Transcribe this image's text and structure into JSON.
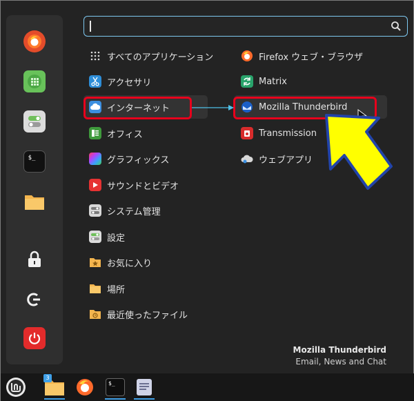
{
  "search": {
    "placeholder": ""
  },
  "favorites": [
    {
      "name": "firefox"
    },
    {
      "name": "calculator"
    },
    {
      "name": "settings"
    },
    {
      "name": "terminal"
    },
    {
      "name": "files"
    },
    {
      "name": "lock"
    },
    {
      "name": "logout"
    },
    {
      "name": "power"
    }
  ],
  "categories": [
    {
      "label": "すべてのアプリケーション",
      "icon": "grid-icon"
    },
    {
      "label": "アクセサリ",
      "icon": "scissors-icon"
    },
    {
      "label": "インターネット",
      "icon": "cloud-icon"
    },
    {
      "label": "オフィス",
      "icon": "office-icon"
    },
    {
      "label": "グラフィックス",
      "icon": "graphics-icon"
    },
    {
      "label": "サウンドとビデオ",
      "icon": "play-icon"
    },
    {
      "label": "システム管理",
      "icon": "system-icon"
    },
    {
      "label": "設定",
      "icon": "toggle-icon"
    },
    {
      "label": "お気に入り",
      "icon": "folder-star-icon"
    },
    {
      "label": "場所",
      "icon": "folder-icon"
    },
    {
      "label": "最近使ったファイル",
      "icon": "folder-recent-icon"
    }
  ],
  "apps": [
    {
      "label": "Firefox ウェブ・ブラウザ",
      "icon": "firefox-icon"
    },
    {
      "label": "Matrix",
      "icon": "matrix-icon"
    },
    {
      "label": "Mozilla Thunderbird",
      "icon": "thunderbird-icon"
    },
    {
      "label": "Transmission",
      "icon": "transmission-icon"
    },
    {
      "label": "ウェブアプリ",
      "icon": "webapp-icon"
    }
  ],
  "description": {
    "title": "Mozilla Thunderbird",
    "subtitle": "Email, News and Chat"
  },
  "panel": {
    "files_badge": "3"
  },
  "colors": {
    "accent": "#3fa0e8",
    "highlight_box": "#e8001c",
    "arrow_fill": "#ffff00",
    "arrow_stroke": "#2244aa"
  }
}
